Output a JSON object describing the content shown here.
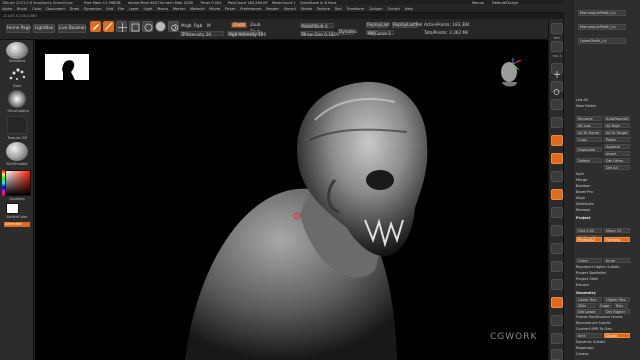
{
  "titlebar": {
    "title": "ZBrush 2023.0.6 Smalljects Draw/Grow",
    "status": [
      "Free Mem 11.998GB",
      "Active Mem 6027",
      "Scratch Disk 4238",
      "Timer 0.001",
      "PolyCount 183,284 KP",
      "MeshCount 1"
    ],
    "quicksave": "QuickSave In 8 Secs",
    "right_items": [
      "Menus",
      "DefaultZScript"
    ]
  },
  "menus": [
    "Alpha",
    "Brush",
    "Color",
    "Document",
    "Draw",
    "Dynamics",
    "Edit",
    "File",
    "Layer",
    "Light",
    "Macro",
    "Marker",
    "Material",
    "Movie",
    "Picker",
    "Preferences",
    "Render",
    "Stencil",
    "Stroke",
    "Texture",
    "Tool",
    "Transform",
    "Zplugin",
    "Zscript",
    "Help"
  ],
  "subinfo": "-0.145,0.330,0.867",
  "shelf": {
    "home_page": "Home Page",
    "lightbox": "LightBox",
    "live_boolean": "Live Boolean",
    "edit": "Edit",
    "draw": "Draw",
    "move": "Move",
    "scale": "Scale",
    "rotate": "Rotate",
    "mrgb": "Mrgb",
    "rgb": "Rgb",
    "m": "M",
    "zadd": "Zadd",
    "zsub": "Zsub",
    "zcut": "Zcut",
    "focal_shift": "Focal Shift 0",
    "draw_size": "Draw Size 0.1829",
    "rgb_intensity": "Rgb Intensity 100",
    "z_intensity": "Z Intensity 20",
    "dynamic": "Dynamic",
    "replaylast": "ReplayLast",
    "replaylastrel": "ReplayLastRel",
    "active_points": "ActivePoints: 183,384",
    "total_points": "TotalPoints: 3.362 Mil",
    "adj_curve": "AdjCurve 1"
  },
  "left": {
    "brush_label": "Standard",
    "stroke_label": "Dots",
    "alpha_label": "~Brushalpha",
    "texture_label": "Texture Off",
    "material_label": "SkinShade4",
    "gradient": "Gradient",
    "switch_color": "SwitchColor",
    "alternate": "Alternate"
  },
  "strip": [
    "BPR",
    "SPix 3",
    "Scroll",
    "Zoom",
    "Actual",
    "AAHalf",
    "Dynamic",
    "Persp",
    "Floor",
    "Local",
    "L.Sym",
    "Xyz",
    "Frame",
    "Move",
    "Scale",
    "Rotate",
    "Line Fill",
    "PolyF",
    "Transp",
    "Ghost",
    "Solo",
    "Xpose"
  ],
  "palette": {
    "subtools": [
      "MannequinTeeth_Lo",
      "MannequinTeeth_Lo",
      "LowerTeeth_Lo"
    ],
    "list_all": "List All",
    "new_folder": "New Folder",
    "rows": [
      "Rename",
      "AutoReorder",
      "All Low",
      "All High",
      "All To Home",
      "All To Target",
      "Copy",
      "Paste",
      "Append",
      "Duplicate",
      "Insert",
      "Delete",
      "Del Other",
      "Del All",
      "Split",
      "Merge",
      "Boolean",
      "Bevel Pro",
      "Align",
      "Distribute",
      "Remesh",
      "Project"
    ],
    "project_items": [
      "Dist 0.02",
      "Mean 25",
      "PA Blur 10",
      "ProjectAll",
      "Farthest",
      "Outer",
      "Inner",
      "Reproject Higher Subdiv",
      "Project BasRelief"
    ],
    "project_shell": "Project Shell",
    "extract": "Extract",
    "geometry_head": "Geometry",
    "geometry_rows": [
      "Lower Res",
      "Higher Res",
      "SDiv",
      "Cage",
      "Rstr",
      "Del Lower",
      "Del Higher",
      "Freeze SubDivision Levels",
      "Reconstruct Subdiv",
      "Convert BPR To Geo",
      "Divide",
      "Smt",
      "Suv",
      "ReUV"
    ],
    "dynamic_subdiv": "Dynamic Subdiv",
    "edgeloop": "EdgeLoop",
    "crease": "Crease",
    "shadowbox": "ShadowBox",
    "claypolish": "ClayPolish",
    "dynamesh": "DynaMesh",
    "tessimate": "Tessimate",
    "zremesher": "ZRemesher"
  },
  "watermark": "CGWORK"
}
